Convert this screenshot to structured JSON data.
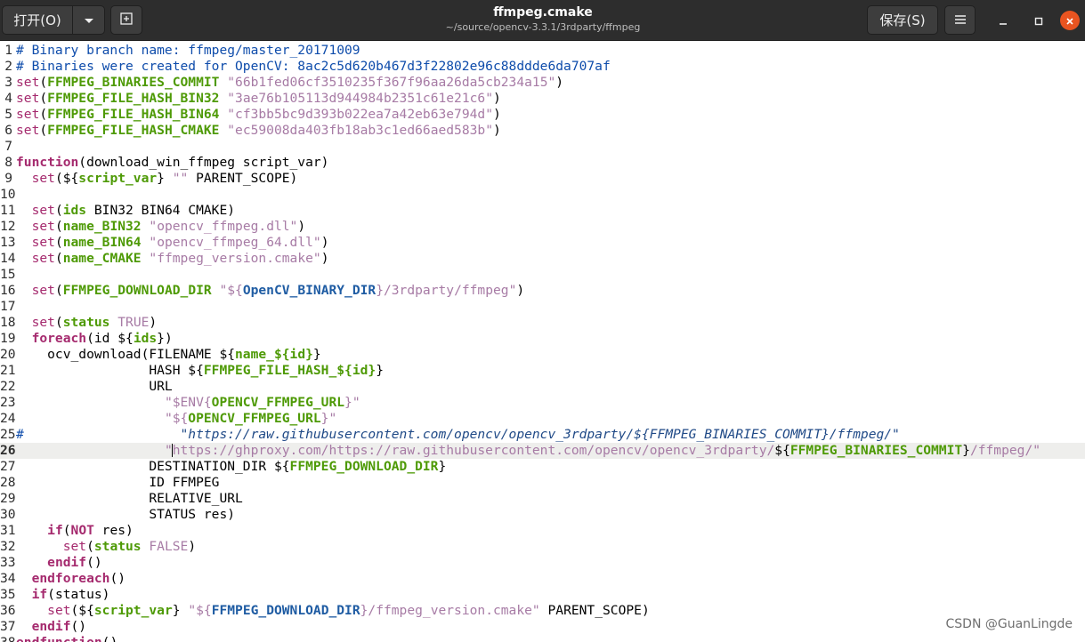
{
  "header": {
    "open_label": "打开(O)",
    "save_label": "保存(S)",
    "title": "ffmpeg.cmake",
    "subtitle": "~/source/opencv-3.3.1/3rdparty/ffmpeg"
  },
  "icons": {
    "open_arrow": "chevron-down-icon",
    "new_tab": "new-tab-icon",
    "menu": "hamburger-menu-icon",
    "minimize": "minimize-icon",
    "maximize": "maximize-icon",
    "close": "close-icon"
  },
  "colors": {
    "header_bg": "#2d2d2d",
    "close_button": "#e95420",
    "comment": "#0e4cab",
    "string": "#a77ba5",
    "variable": "#4e9a06",
    "keyword": "#a52a6e"
  },
  "editor": {
    "current_line": 26,
    "lines": [
      {
        "n": "1",
        "code": [
          [
            "c-com",
            "# Binary branch name: ffmpeg/master_20171009"
          ]
        ]
      },
      {
        "n": "2",
        "code": [
          [
            "c-com",
            "# Binaries were created for OpenCV: 8ac2c5d620b467d3f22802e96c88ddde6da707af"
          ]
        ]
      },
      {
        "n": "3",
        "code": [
          [
            "c-kw",
            "set"
          ],
          [
            "",
            "("
          ],
          [
            "c-var",
            "FFMPEG_BINARIES_COMMIT"
          ],
          [
            "",
            " "
          ],
          [
            "c-str",
            "\"66b1fed06cf3510235f367f96aa26da5cb234a15\""
          ],
          [
            "",
            ")"
          ]
        ]
      },
      {
        "n": "4",
        "code": [
          [
            "c-kw",
            "set"
          ],
          [
            "",
            "("
          ],
          [
            "c-var",
            "FFMPEG_FILE_HASH_BIN32"
          ],
          [
            "",
            " "
          ],
          [
            "c-str",
            "\"3ae76b105113d944984b2351c61e21c6\""
          ],
          [
            "",
            ")"
          ]
        ]
      },
      {
        "n": "5",
        "code": [
          [
            "c-kw",
            "set"
          ],
          [
            "",
            "("
          ],
          [
            "c-var",
            "FFMPEG_FILE_HASH_BIN64"
          ],
          [
            "",
            " "
          ],
          [
            "c-str",
            "\"cf3bb5bc9d393b022ea7a42eb63e794d\""
          ],
          [
            "",
            ")"
          ]
        ]
      },
      {
        "n": "6",
        "code": [
          [
            "c-kw",
            "set"
          ],
          [
            "",
            "("
          ],
          [
            "c-var",
            "FFMPEG_FILE_HASH_CMAKE"
          ],
          [
            "",
            " "
          ],
          [
            "c-str",
            "\"ec59008da403fb18ab3c1ed66aed583b\""
          ],
          [
            "",
            ")"
          ]
        ]
      },
      {
        "n": "7",
        "code": []
      },
      {
        "n": "8",
        "code": [
          [
            "c-fn",
            "function"
          ],
          [
            "",
            "(download_win_ffmpeg script_var)"
          ]
        ]
      },
      {
        "n": "9",
        "code": [
          [
            "",
            "  "
          ],
          [
            "c-kw",
            "set"
          ],
          [
            "",
            "(${"
          ],
          [
            "c-var",
            "script_var"
          ],
          [
            "",
            "} "
          ],
          [
            "c-str",
            "\"\""
          ],
          [
            "",
            " PARENT_SCOPE)"
          ]
        ]
      },
      {
        "n": "10",
        "code": []
      },
      {
        "n": "11",
        "code": [
          [
            "",
            "  "
          ],
          [
            "c-kw",
            "set"
          ],
          [
            "",
            "("
          ],
          [
            "c-var",
            "ids"
          ],
          [
            "",
            " BIN32 BIN64 CMAKE)"
          ]
        ]
      },
      {
        "n": "12",
        "code": [
          [
            "",
            "  "
          ],
          [
            "c-kw",
            "set"
          ],
          [
            "",
            "("
          ],
          [
            "c-var",
            "name_BIN32"
          ],
          [
            "",
            " "
          ],
          [
            "c-str",
            "\"opencv_ffmpeg.dll\""
          ],
          [
            "",
            ")"
          ]
        ]
      },
      {
        "n": "13",
        "code": [
          [
            "",
            "  "
          ],
          [
            "c-kw",
            "set"
          ],
          [
            "",
            "("
          ],
          [
            "c-var",
            "name_BIN64"
          ],
          [
            "",
            " "
          ],
          [
            "c-str",
            "\"opencv_ffmpeg_64.dll\""
          ],
          [
            "",
            ")"
          ]
        ]
      },
      {
        "n": "14",
        "code": [
          [
            "",
            "  "
          ],
          [
            "c-kw",
            "set"
          ],
          [
            "",
            "("
          ],
          [
            "c-var",
            "name_CMAKE"
          ],
          [
            "",
            " "
          ],
          [
            "c-str",
            "\"ffmpeg_version.cmake\""
          ],
          [
            "",
            ")"
          ]
        ]
      },
      {
        "n": "15",
        "code": []
      },
      {
        "n": "16",
        "code": [
          [
            "",
            "  "
          ],
          [
            "c-kw",
            "set"
          ],
          [
            "",
            "("
          ],
          [
            "c-var",
            "FFMPEG_DOWNLOAD_DIR"
          ],
          [
            "",
            " "
          ],
          [
            "c-str",
            "\"${"
          ],
          [
            "c-sb",
            "OpenCV_BINARY_DIR"
          ],
          [
            "c-str",
            "}/3rdparty/ffmpeg\""
          ],
          [
            "",
            ")"
          ]
        ]
      },
      {
        "n": "17",
        "code": []
      },
      {
        "n": "18",
        "code": [
          [
            "",
            "  "
          ],
          [
            "c-kw",
            "set"
          ],
          [
            "",
            "("
          ],
          [
            "c-var",
            "status"
          ],
          [
            "",
            " "
          ],
          [
            "c-str",
            "TRUE"
          ],
          [
            "",
            ")"
          ]
        ]
      },
      {
        "n": "19",
        "code": [
          [
            "",
            "  "
          ],
          [
            "c-fn",
            "foreach"
          ],
          [
            "",
            "(id ${"
          ],
          [
            "c-var",
            "ids"
          ],
          [
            "",
            "})"
          ]
        ]
      },
      {
        "n": "20",
        "code": [
          [
            "",
            "    ocv_download(FILENAME ${"
          ],
          [
            "c-var",
            "name_${"
          ],
          [
            "c-var",
            "id"
          ],
          [
            "c-var",
            "}"
          ],
          [
            "",
            "}"
          ]
        ]
      },
      {
        "n": "21",
        "code": [
          [
            "",
            "                 HASH ${"
          ],
          [
            "c-var",
            "FFMPEG_FILE_HASH_${"
          ],
          [
            "c-var",
            "id"
          ],
          [
            "c-var",
            "}"
          ],
          [
            "",
            "}"
          ]
        ]
      },
      {
        "n": "22",
        "code": [
          [
            "",
            "                 URL"
          ]
        ]
      },
      {
        "n": "23",
        "code": [
          [
            "",
            "                   "
          ],
          [
            "c-str",
            "\"$ENV{"
          ],
          [
            "c-var",
            "OPENCV_FFMPEG_URL"
          ],
          [
            "c-str",
            "}\""
          ]
        ]
      },
      {
        "n": "24",
        "code": [
          [
            "",
            "                   "
          ],
          [
            "c-str",
            "\"${"
          ],
          [
            "c-var",
            "OPENCV_FFMPEG_URL"
          ],
          [
            "c-str",
            "}\""
          ]
        ]
      },
      {
        "n": "25",
        "code": [
          [
            "c-com",
            "#                    "
          ],
          [
            "c-url",
            "\"https://raw.githubusercontent.com/opencv/opencv_3rdparty/${FFMPEG_BINARIES_COMMIT}/ffmpeg/\""
          ]
        ]
      },
      {
        "n": "26",
        "code": [
          [
            "",
            "                   "
          ],
          [
            "c-str",
            "\""
          ],
          [
            "cursor",
            ""
          ],
          [
            "c-str",
            "https://ghproxy.com/https://raw.githubusercontent.com/opencv/opencv_3rdparty/"
          ],
          [
            "",
            "${"
          ],
          [
            "c-var",
            "FFMPEG_BINARIES_COMMIT"
          ],
          [
            "",
            "}"
          ],
          [
            "c-str",
            "/ffmpeg/\""
          ]
        ]
      },
      {
        "n": "27",
        "code": [
          [
            "",
            "                 DESTINATION_DIR ${"
          ],
          [
            "c-var",
            "FFMPEG_DOWNLOAD_DIR"
          ],
          [
            "",
            "}"
          ]
        ]
      },
      {
        "n": "28",
        "code": [
          [
            "",
            "                 ID FFMPEG"
          ]
        ]
      },
      {
        "n": "29",
        "code": [
          [
            "",
            "                 RELATIVE_URL"
          ]
        ]
      },
      {
        "n": "30",
        "code": [
          [
            "",
            "                 STATUS res)"
          ]
        ]
      },
      {
        "n": "31",
        "code": [
          [
            "",
            "    "
          ],
          [
            "c-fn",
            "if"
          ],
          [
            "",
            "("
          ],
          [
            "c-fn",
            "NOT"
          ],
          [
            "",
            " res)"
          ]
        ]
      },
      {
        "n": "32",
        "code": [
          [
            "",
            "      "
          ],
          [
            "c-kw",
            "set"
          ],
          [
            "",
            "("
          ],
          [
            "c-var",
            "status"
          ],
          [
            "",
            " "
          ],
          [
            "c-str",
            "FALSE"
          ],
          [
            "",
            ")"
          ]
        ]
      },
      {
        "n": "33",
        "code": [
          [
            "",
            "    "
          ],
          [
            "c-fn",
            "endif"
          ],
          [
            "",
            "()"
          ]
        ]
      },
      {
        "n": "34",
        "code": [
          [
            "",
            "  "
          ],
          [
            "c-fn",
            "endforeach"
          ],
          [
            "",
            "()"
          ]
        ]
      },
      {
        "n": "35",
        "code": [
          [
            "",
            "  "
          ],
          [
            "c-fn",
            "if"
          ],
          [
            "",
            "(status)"
          ]
        ]
      },
      {
        "n": "36",
        "code": [
          [
            "",
            "    "
          ],
          [
            "c-kw",
            "set"
          ],
          [
            "",
            "(${"
          ],
          [
            "c-var",
            "script_var"
          ],
          [
            "",
            "} "
          ],
          [
            "c-str",
            "\"${"
          ],
          [
            "c-sb",
            "FFMPEG_DOWNLOAD_DIR"
          ],
          [
            "c-str",
            "}/ffmpeg_version.cmake\""
          ],
          [
            "",
            " PARENT_SCOPE)"
          ]
        ]
      },
      {
        "n": "37",
        "code": [
          [
            "",
            "  "
          ],
          [
            "c-fn",
            "endif"
          ],
          [
            "",
            "()"
          ]
        ]
      },
      {
        "n": "38",
        "code": [
          [
            "c-fn",
            "endfunction"
          ],
          [
            "",
            "()"
          ]
        ]
      }
    ]
  },
  "watermark": "CSDN @GuanLingde"
}
